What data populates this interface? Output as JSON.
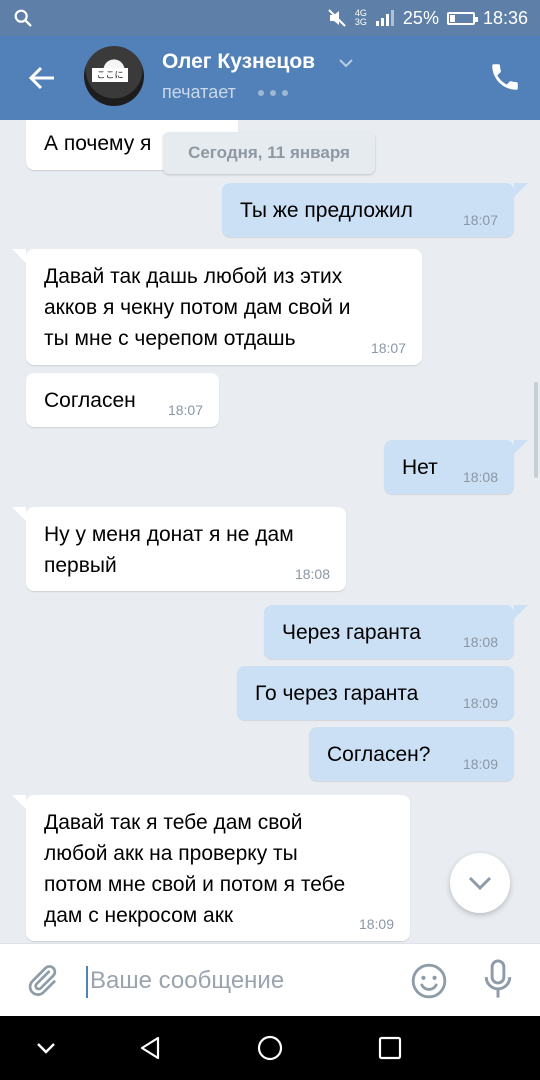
{
  "status_bar": {
    "network_top": "4G",
    "network_bottom": "3G",
    "battery_text": "25%",
    "battery_level": 0.25,
    "time": "18:36"
  },
  "header": {
    "contact_name": "Олег Кузнецов",
    "status": "печатает",
    "avatar_sign": "ここに"
  },
  "chat": {
    "date_separator": "Сегодня, 11 января",
    "partial_message": "А почему я",
    "messages": [
      {
        "dir": "out",
        "lines": [
          "Ты же предложил"
        ],
        "time": "18:07"
      },
      {
        "dir": "in",
        "lines": [
          "Давай так дашь любой из этих",
          "акков я чекну потом дам свой и",
          "ты мне с черепом отдашь"
        ],
        "time": "18:07"
      },
      {
        "dir": "in",
        "lines": [
          "Согласен"
        ],
        "time": "18:07"
      },
      {
        "dir": "out",
        "lines": [
          "Нет"
        ],
        "time": "18:08"
      },
      {
        "dir": "in",
        "lines": [
          "Ну у меня донат я не дам",
          "первый"
        ],
        "time": "18:08"
      },
      {
        "dir": "out",
        "lines": [
          "Через гаранта"
        ],
        "time": "18:08"
      },
      {
        "dir": "out",
        "lines": [
          "Го через гаранта"
        ],
        "time": "18:09"
      },
      {
        "dir": "out",
        "lines": [
          "Согласен?"
        ],
        "time": "18:09"
      },
      {
        "dir": "in",
        "lines": [
          "Давай так я тебе дам свой",
          "любой акк на проверку ты",
          "потом мне свой и потом я тебе",
          "дам с некросом акк"
        ],
        "time": "18:09"
      }
    ]
  },
  "composer": {
    "placeholder": "Ваше сообщение",
    "value": ""
  },
  "colors": {
    "header": "#5181b8",
    "status_bar": "#5e80a8",
    "outgoing_bubble": "#cce0f5",
    "incoming_bubble": "#ffffff",
    "background": "#e9edf2"
  },
  "icons": [
    "search-icon",
    "mute-icon",
    "signal-icon",
    "battery-icon",
    "back-icon",
    "chevron-down-icon",
    "call-icon",
    "scroll-down-icon",
    "attach-icon",
    "emoji-icon",
    "mic-icon",
    "nav-collapse-icon",
    "nav-back-icon",
    "nav-home-icon",
    "nav-recents-icon"
  ]
}
